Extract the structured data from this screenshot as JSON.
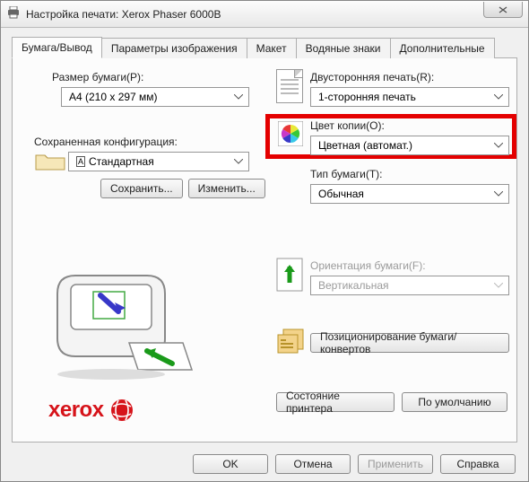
{
  "window": {
    "title": "Настройка печати: Xerox Phaser 6000B"
  },
  "tabs": {
    "t0": "Бумага/Вывод",
    "t1": "Параметры изображения",
    "t2": "Макет",
    "t3": "Водяные знаки",
    "t4": "Дополнительные"
  },
  "left": {
    "paperSize": {
      "label": "Размер бумаги(P):",
      "value": "A4 (210 x 297 мм)"
    },
    "savedConfig": {
      "label": "Сохраненная конфигурация:",
      "value": "Стандартная"
    },
    "saveBtn": "Сохранить...",
    "editBtn": "Изменить..."
  },
  "right": {
    "duplex": {
      "label": "Двусторонняя печать(R):",
      "value": "1-сторонняя печать"
    },
    "copyColor": {
      "label": "Цвет копии(O):",
      "value": "Цветная (автомат.)"
    },
    "paperType": {
      "label": "Тип бумаги(T):",
      "value": "Обычная"
    },
    "orientation": {
      "label": "Ориентация бумаги(F):",
      "value": "Вертикальная"
    },
    "positioningBtn": "Позиционирование бумаги/конвертов",
    "statusBtn": "Состояние принтера",
    "defaultsBtn": "По умолчанию"
  },
  "brand": "xerox",
  "footer": {
    "ok": "OK",
    "cancel": "Отмена",
    "apply": "Применить",
    "help": "Справка"
  }
}
